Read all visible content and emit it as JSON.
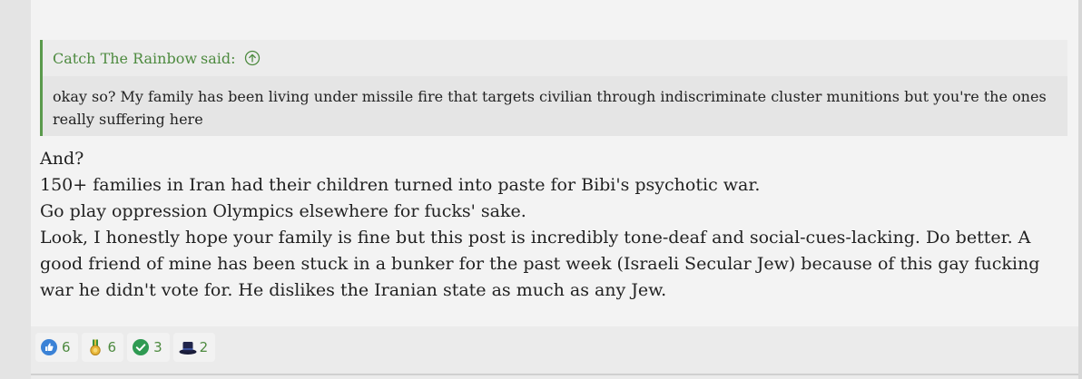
{
  "quote": {
    "author": "Catch The Rainbow",
    "said": "said:",
    "text": "okay so? My family has been living under missile fire that targets civilian through indiscriminate cluster munitions but you're the ones really suffering here"
  },
  "body": {
    "lines": [
      "And?",
      "150+ families in Iran had their children turned into paste for Bibi's psychotic war.",
      "Go play oppression Olympics elsewhere for fucks' sake.",
      "Look, I honestly hope your family is fine but this post is incredibly tone-deaf and social-cues-lacking. Do better. A good friend of mine has been stuck in a bunker for the past week (Israeli Secular Jew) because of this gay fucking war he didn't vote for. He dislikes the Iranian state as much as any Jew."
    ]
  },
  "reactions": [
    {
      "icon": "thumbs-up-icon",
      "count": "6"
    },
    {
      "icon": "medal-icon",
      "count": "6"
    },
    {
      "icon": "checkmark-icon",
      "count": "3"
    },
    {
      "icon": "top-hat-icon",
      "count": "2"
    }
  ],
  "colors": {
    "accent_green": "#4d8a3f",
    "quote_bar": "#5a9a4c"
  }
}
